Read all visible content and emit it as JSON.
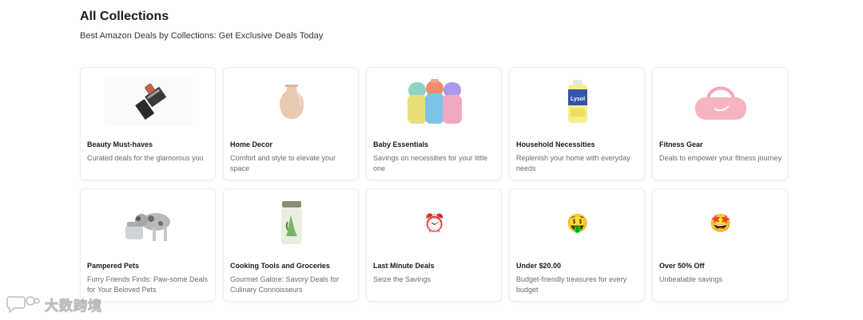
{
  "header": {
    "title": "All Collections",
    "subtitle": "Best Amazon Deals by Collections: Get Exclusive Deals Today"
  },
  "collections": [
    {
      "title": "Beauty Must-haves",
      "description": "Curated deals for the glamorous you",
      "icon": "lipstick-icon"
    },
    {
      "title": "Home Decor",
      "description": "Comfort and style to elevate your space",
      "icon": "vase-icon"
    },
    {
      "title": "Baby Essentials",
      "description": "Savings on necessities for your little one",
      "icon": "baby-bottles-icon"
    },
    {
      "title": "Household Necessities",
      "description": "Replenish your home with everyday needs",
      "icon": "disinfectant-spray-icon"
    },
    {
      "title": "Fitness Gear",
      "description": "Deals to empower your fitness journey",
      "icon": "gym-bag-icon"
    },
    {
      "title": "Pampered Pets",
      "description": "Furry Friends Finds: Paw-some Deals for Your Beloved Pets",
      "icon": "dog-icon"
    },
    {
      "title": "Cooking Tools and Groceries",
      "description": "Gourmet Galore: Savory Deals for Culinary Connoisseurs",
      "icon": "spice-jar-icon"
    },
    {
      "title": "Last Minute Deals",
      "description": "Seize the Savings",
      "icon": "alarm-clock-icon",
      "glyph": "⏰"
    },
    {
      "title": "Under $20.00",
      "description": "Budget-friendly treasures for every budget",
      "icon": "money-mouth-face-icon",
      "glyph": "🤑"
    },
    {
      "title": "Over 50% Off",
      "description": "Unbeatable savings",
      "icon": "star-struck-face-icon",
      "glyph": "🤩"
    }
  ],
  "watermark": {
    "text": "大数跨境",
    "icon": "chat-bubble-logo-icon"
  }
}
